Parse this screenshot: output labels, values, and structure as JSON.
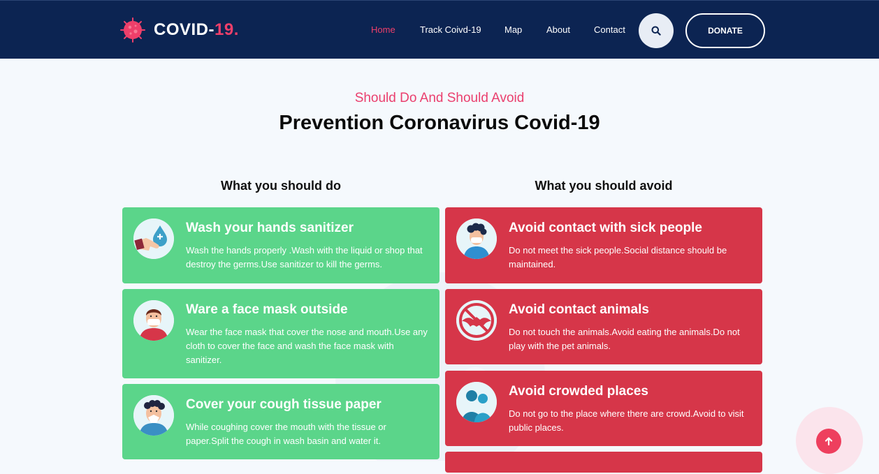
{
  "nav": {
    "logo_text": "COVID-",
    "logo_accent": "19.",
    "links": [
      "Home",
      "Track Coivd-19",
      "Map",
      "About",
      "Contact"
    ],
    "active_link": "Home",
    "donate_label": "DONATE"
  },
  "section": {
    "subtitle": "Should Do And Should Avoid",
    "title": "Prevention Coronavirus Covid-19"
  },
  "do_column": {
    "heading": "What you should do",
    "cards": [
      {
        "title": "Wash your hands sanitizer",
        "desc": "Wash the hands properly .Wash with the liquid or shop that destroy the germs.Use sanitizer to kill the germs.",
        "icon": "hand-wash-icon"
      },
      {
        "title": "Ware a face mask outside",
        "desc": "Wear the face mask that cover the nose and mouth.Use any cloth to cover the face and wash the face mask with sanitizer.",
        "icon": "face-mask-icon"
      },
      {
        "title": "Cover your cough tissue paper",
        "desc": "While coughing cover the mouth with the tissue or paper.Split the cough in wash basin and water it.",
        "icon": "cough-tissue-icon"
      }
    ]
  },
  "avoid_column": {
    "heading": "What you should avoid",
    "cards": [
      {
        "title": "Avoid contact with sick people",
        "desc": "Do not meet the sick people.Social distance should be maintained.",
        "icon": "sick-person-icon"
      },
      {
        "title": "Avoid contact animals",
        "desc": "Do not touch the animals.Avoid eating the animals.Do not play with the pet animals.",
        "icon": "no-bat-icon"
      },
      {
        "title": "Avoid crowded places",
        "desc": "Do not go to the place where there are crowd.Avoid to visit public places.",
        "icon": "crowd-icon"
      }
    ]
  },
  "colors": {
    "navbar": "#0c2452",
    "accent": "#ee3f6a",
    "do_card": "#5bd58a",
    "avoid_card": "#d63649"
  }
}
